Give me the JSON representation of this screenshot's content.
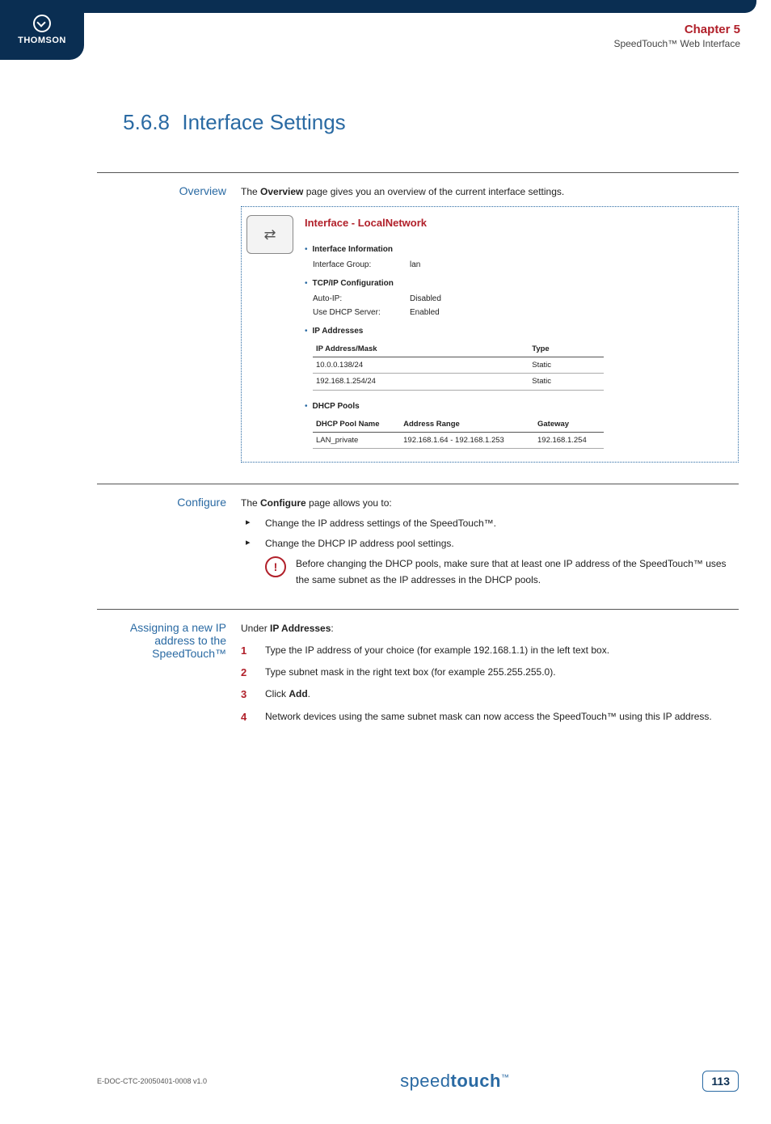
{
  "header": {
    "brand": "THOMSON",
    "chapter": "Chapter 5",
    "subtitle": "SpeedTouch™ Web Interface"
  },
  "section": {
    "number": "5.6.8",
    "title": "Interface Settings"
  },
  "overview": {
    "label": "Overview",
    "intro_pre": "The ",
    "intro_bold": "Overview",
    "intro_post": " page gives you an overview of the current interface settings.",
    "panel": {
      "title": "Interface - LocalNetwork",
      "info_heading": "Interface Information",
      "info": {
        "group_k": "Interface Group:",
        "group_v": "lan"
      },
      "tcp_heading": "TCP/IP Configuration",
      "tcp": {
        "auto_k": "Auto-IP:",
        "auto_v": "Disabled",
        "dhcp_k": "Use DHCP Server:",
        "dhcp_v": "Enabled"
      },
      "ip_heading": "IP Addresses",
      "ip_table": {
        "h1": "IP Address/Mask",
        "h2": "Type",
        "rows": [
          {
            "c1": "10.0.0.138/24",
            "c2": "Static"
          },
          {
            "c1": "192.168.1.254/24",
            "c2": "Static"
          }
        ]
      },
      "pool_heading": "DHCP Pools",
      "pool_table": {
        "h1": "DHCP Pool Name",
        "h2": "Address Range",
        "h3": "Gateway",
        "rows": [
          {
            "c1": "LAN_private",
            "c2": "192.168.1.64 - 192.168.1.253",
            "c3": "192.168.1.254"
          }
        ]
      }
    }
  },
  "configure": {
    "label": "Configure",
    "intro_pre": "The ",
    "intro_bold": "Configure",
    "intro_post": " page allows you to:",
    "items": [
      "Change the IP address settings of the SpeedTouch™.",
      "Change the DHCP IP address pool settings."
    ],
    "note": "Before changing the DHCP pools, make sure that at least one IP address of the SpeedTouch™ uses the same subnet as the IP addresses in the DHCP pools."
  },
  "assign": {
    "label": "Assigning a new IP address to the SpeedTouch™",
    "under_pre": "Under ",
    "under_bold": "IP Addresses",
    "under_post": ":",
    "steps": [
      "Type the IP address of your choice (for example 192.168.1.1) in the left text box.",
      "Type subnet mask in the right text box (for example 255.255.255.0).",
      "Click Add.",
      "Network devices using the same subnet mask can now access the SpeedTouch™ using this IP address."
    ],
    "step3_pre": "Click ",
    "step3_bold": "Add",
    "step3_post": "."
  },
  "footer": {
    "docref": "E-DOC-CTC-20050401-0008 v1.0",
    "logo_light": "speed",
    "logo_bold": "touch",
    "logo_tm": "™",
    "page": "113"
  }
}
